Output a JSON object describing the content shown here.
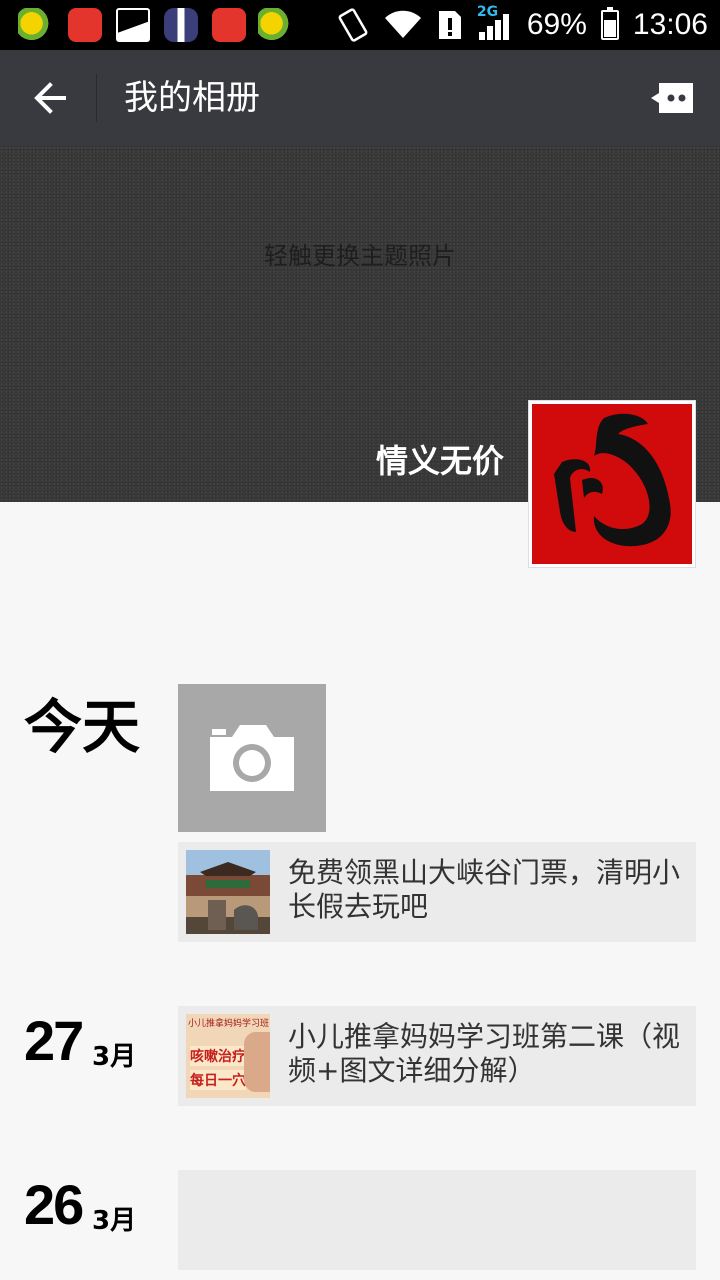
{
  "status_bar": {
    "battery": "69%",
    "time": "13:06",
    "network": "2G",
    "app_icons": [
      "360-mail-icon",
      "huawei-icon",
      "gallery-icon",
      "tuxedo-icon",
      "huawei-icon",
      "360-mail-icon"
    ]
  },
  "header": {
    "title": "我的相册",
    "back_icon": "arrow-left-icon",
    "message_icon": "message-icon"
  },
  "cover": {
    "hint": "轻触更换主题照片",
    "username": "情义无价"
  },
  "feed": {
    "today_label": "今天",
    "camera_icon": "camera-icon",
    "posts": [
      {
        "text": "免费领黑山大峡谷门票，清明小长假去玩吧"
      },
      {
        "text": "小儿推拿妈妈学习班第二课（视频+图文详细分解）"
      }
    ],
    "dates": [
      {
        "day": "27",
        "month": "3月"
      },
      {
        "day": "26",
        "month": "3月"
      }
    ],
    "thumb2_lines": [
      "小儿推拿妈妈学习班",
      "咳嗽治疗",
      "每日一穴"
    ]
  },
  "colors": {
    "titlebar": "#393a3f",
    "statusbar": "#000000",
    "avatar_red": "#d10b0b",
    "post_bg": "#ebebeb",
    "camera_tile": "#a8a8a8"
  }
}
